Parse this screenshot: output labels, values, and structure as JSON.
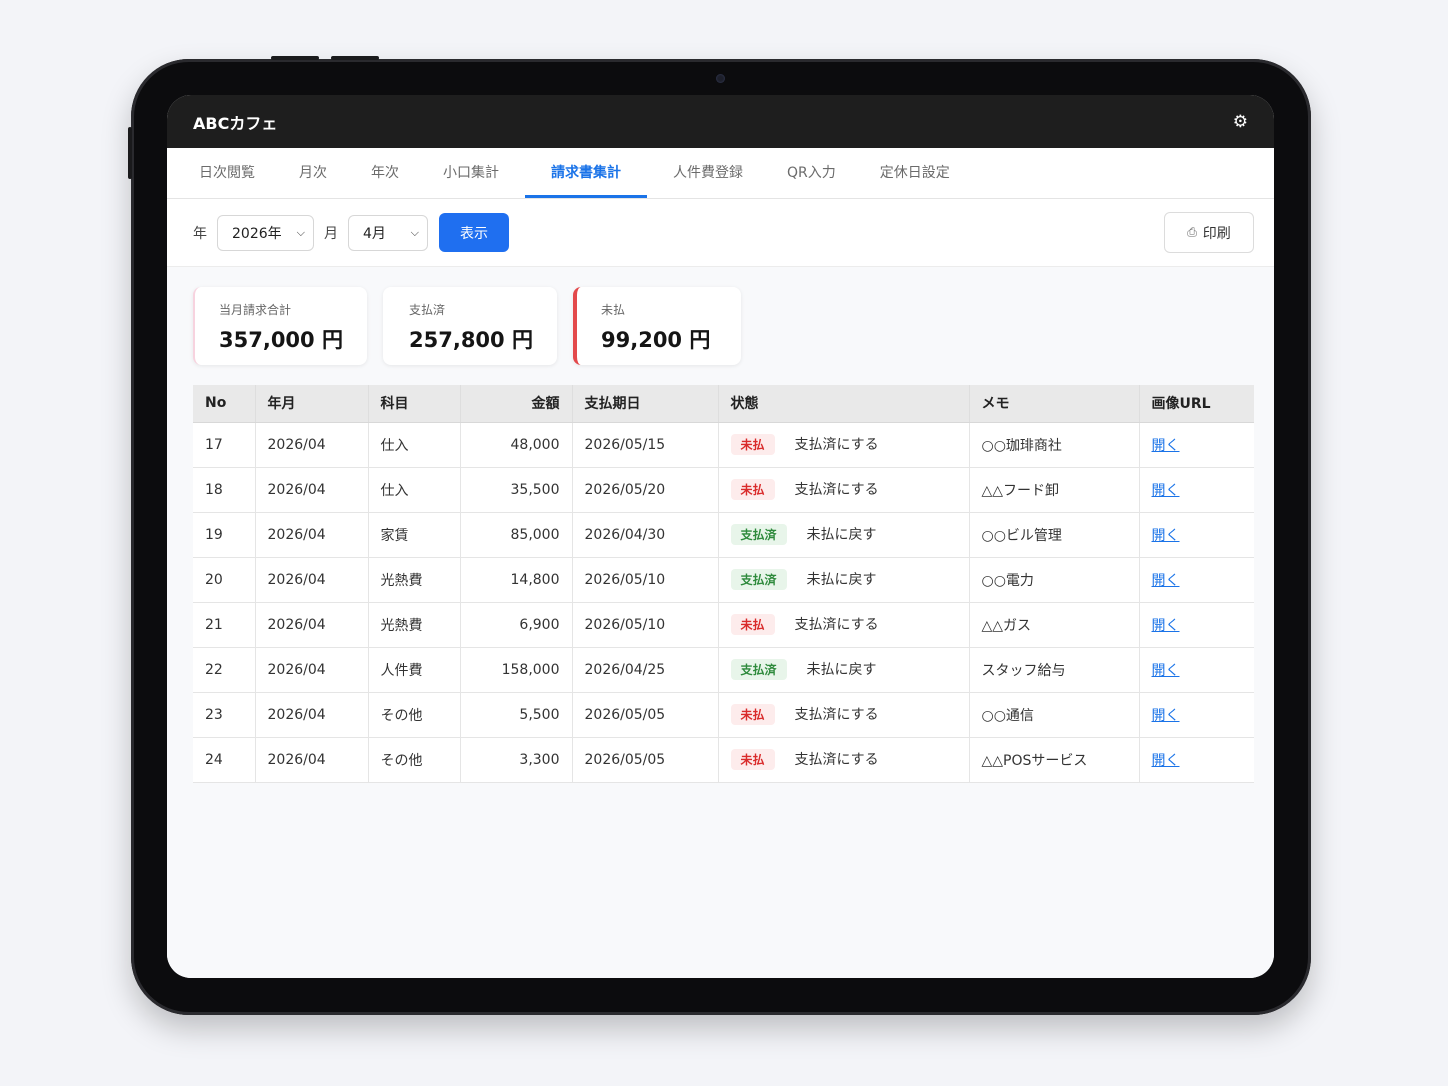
{
  "app": {
    "title": "ABCカフェ"
  },
  "tabs": [
    {
      "label": "日次閲覧",
      "active": false
    },
    {
      "label": "月次",
      "active": false
    },
    {
      "label": "年次",
      "active": false
    },
    {
      "label": "小口集計",
      "active": false
    },
    {
      "label": "請求書集計",
      "active": true
    },
    {
      "label": "人件費登録",
      "active": false
    },
    {
      "label": "QR入力",
      "active": false
    },
    {
      "label": "定休日設定",
      "active": false
    }
  ],
  "filters": {
    "year_label": "年",
    "year_value": "2026年",
    "month_label": "月",
    "month_value": "4月",
    "show_label": "表示",
    "print_label": "印刷"
  },
  "summary": {
    "total_label": "当月請求合計",
    "total_value": "357,000 円",
    "paid_label": "支払済",
    "paid_value": "257,800 円",
    "unpaid_label": "未払",
    "unpaid_value": "99,200 円"
  },
  "table": {
    "columns": [
      "No",
      "年月",
      "科目",
      "金額",
      "支払期日",
      "状態",
      "メモ",
      "画像URL"
    ],
    "rows": [
      {
        "no": "17",
        "ym": "2026/04",
        "subject": "仕入",
        "amount": "48,000",
        "due": "2026/05/15",
        "status": "未払",
        "status_type": "unpaid",
        "action": "支払済にする",
        "memo": "○○珈琲商社",
        "link": "開く"
      },
      {
        "no": "18",
        "ym": "2026/04",
        "subject": "仕入",
        "amount": "35,500",
        "due": "2026/05/20",
        "status": "未払",
        "status_type": "unpaid",
        "action": "支払済にする",
        "memo": "△△フード卸",
        "link": "開く"
      },
      {
        "no": "19",
        "ym": "2026/04",
        "subject": "家賃",
        "amount": "85,000",
        "due": "2026/04/30",
        "status": "支払済",
        "status_type": "paid",
        "action": "未払に戻す",
        "memo": "○○ビル管理",
        "link": "開く"
      },
      {
        "no": "20",
        "ym": "2026/04",
        "subject": "光熱費",
        "amount": "14,800",
        "due": "2026/05/10",
        "status": "支払済",
        "status_type": "paid",
        "action": "未払に戻す",
        "memo": "○○電力",
        "link": "開く"
      },
      {
        "no": "21",
        "ym": "2026/04",
        "subject": "光熱費",
        "amount": "6,900",
        "due": "2026/05/10",
        "status": "未払",
        "status_type": "unpaid",
        "action": "支払済にする",
        "memo": "△△ガス",
        "link": "開く"
      },
      {
        "no": "22",
        "ym": "2026/04",
        "subject": "人件費",
        "amount": "158,000",
        "due": "2026/04/25",
        "status": "支払済",
        "status_type": "paid",
        "action": "未払に戻す",
        "memo": "スタッフ給与",
        "link": "開く"
      },
      {
        "no": "23",
        "ym": "2026/04",
        "subject": "その他",
        "amount": "5,500",
        "due": "2026/05/05",
        "status": "未払",
        "status_type": "unpaid",
        "action": "支払済にする",
        "memo": "○○通信",
        "link": "開く"
      },
      {
        "no": "24",
        "ym": "2026/04",
        "subject": "その他",
        "amount": "3,300",
        "due": "2026/05/05",
        "status": "未払",
        "status_type": "unpaid",
        "action": "支払済にする",
        "memo": "△△POSサービス",
        "link": "開く"
      }
    ]
  },
  "icons": {
    "settings": "gear-icon",
    "print": "printer-icon",
    "dropdown": "chevron-down-icon"
  },
  "colors": {
    "accent": "#1f6ff0",
    "unpaid": "#d92b2b",
    "paid": "#2e8a3c",
    "appbar": "#1e1e1e"
  }
}
